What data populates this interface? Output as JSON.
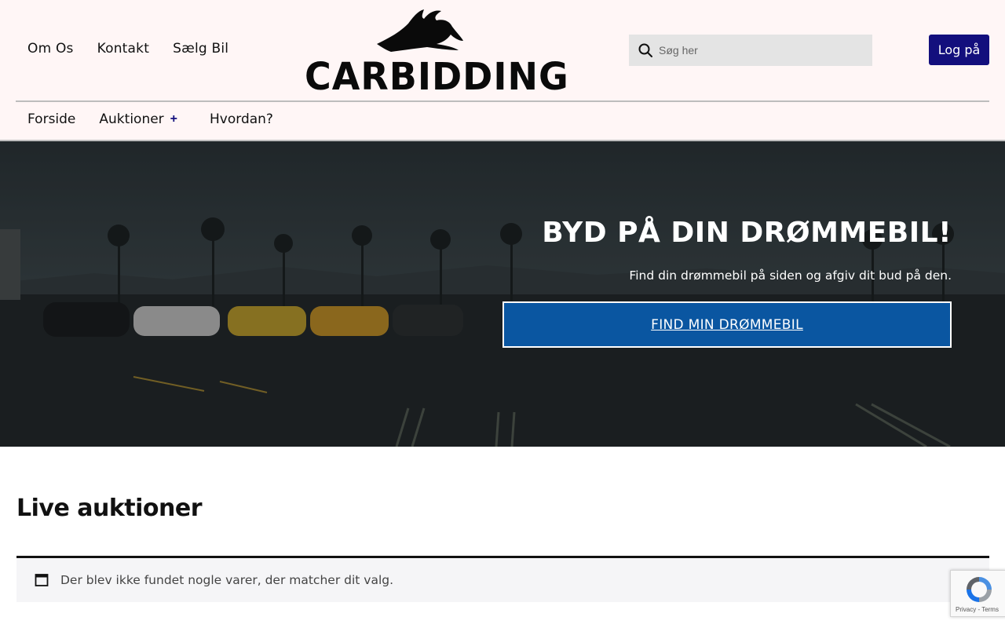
{
  "header": {
    "top_nav": [
      "Om Os",
      "Kontakt",
      "Sælg Bil"
    ],
    "logo_text": "CARBIDDING",
    "search_placeholder": "Søg her",
    "login_label": "Log på"
  },
  "main_nav": {
    "home": "Forside",
    "auctions": "Auktioner",
    "auctions_expand": "+",
    "how": "Hvordan?"
  },
  "hero": {
    "title": "BYD PÅ DIN DRØMMEBIL!",
    "subtitle": "Find din drømmebil på siden og afgiv dit bud på den.",
    "cta_label": "FIND MIN DRØMMEBIL"
  },
  "live": {
    "title": "Live auktioner",
    "empty_notice": "Der blev ikke fundet nogle varer, der matcher dit valg."
  },
  "recaptcha": {
    "footer": "Privacy - Terms"
  },
  "colors": {
    "header_bg": "#fff6f6",
    "login_bg": "#130f7d",
    "cta_bg": "#0a56a1"
  }
}
